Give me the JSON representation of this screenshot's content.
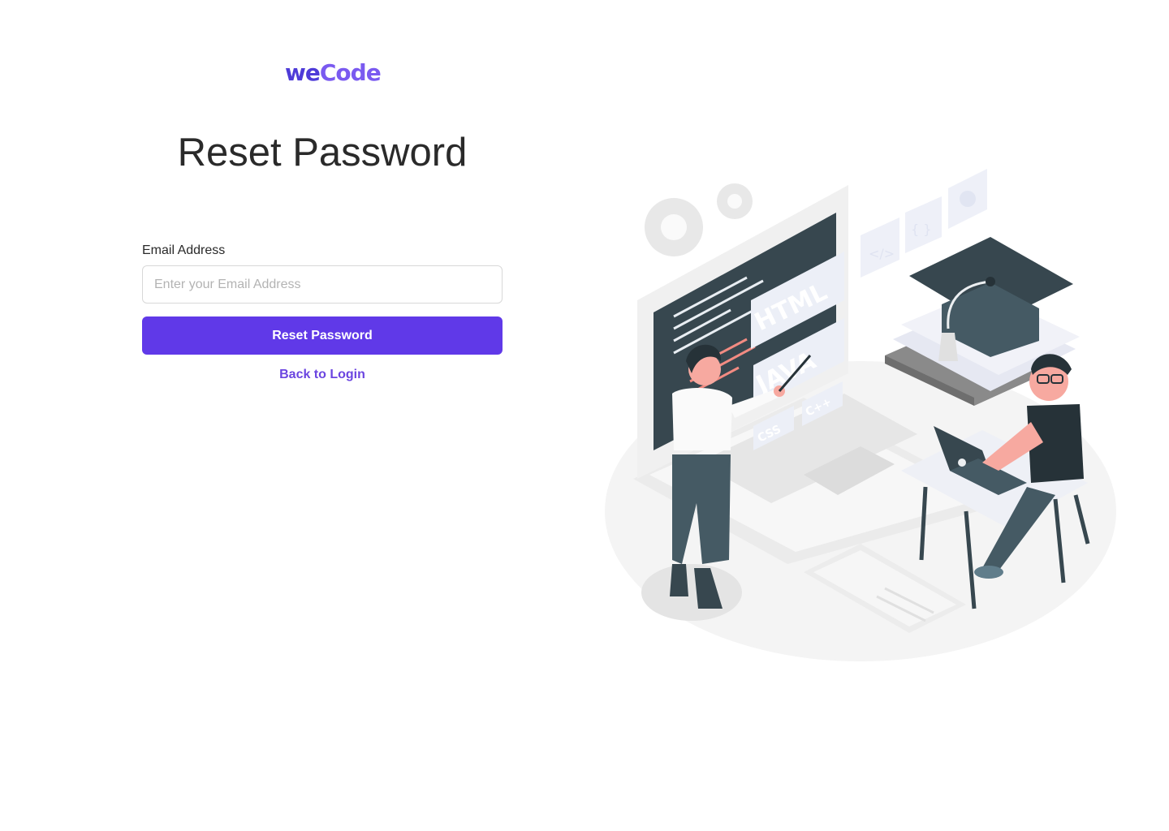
{
  "brand": {
    "logo_we": "we",
    "logo_code": "Code"
  },
  "page": {
    "title": "Reset Password"
  },
  "form": {
    "email_label": "Email Address",
    "email_placeholder": "Enter your Email Address",
    "email_value": "",
    "submit_label": "Reset Password",
    "back_link_label": "Back to Login"
  },
  "illustration": {
    "tags": [
      "HTML",
      "JAVA",
      "CSS",
      "C++"
    ],
    "code_symbols": [
      "</>",
      "{ }"
    ]
  },
  "colors": {
    "primary": "#6039e8",
    "link": "#6b45e0",
    "logo_primary": "#4e3bd8",
    "logo_secondary": "#7a5af0",
    "illustration_dark": "#455a64",
    "illustration_skin": "#f7a9a0"
  },
  "icons": [
    "gear-icon",
    "code-brackets-icon",
    "curly-braces-icon",
    "graduation-cap-icon",
    "laptop-icon"
  ]
}
